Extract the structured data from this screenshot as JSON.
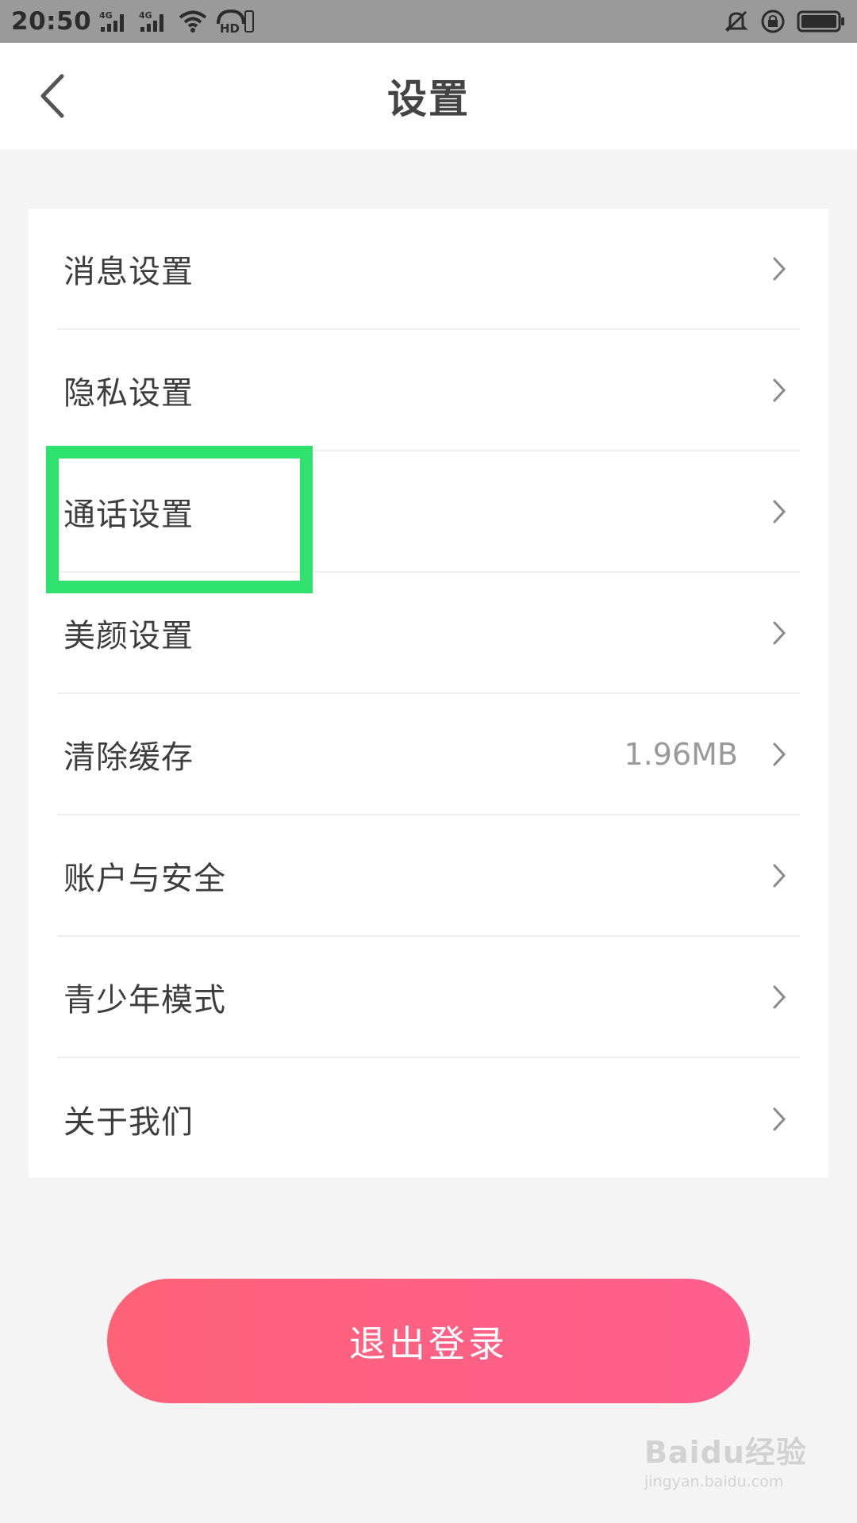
{
  "status_bar": {
    "time": "20:50",
    "network_1": "4G",
    "network_2": "4G",
    "hd_badge": "HD",
    "icons": [
      "signal-icon",
      "signal-icon",
      "wifi-icon",
      "hd-voice-icon",
      "bell-muted-icon",
      "rotation-lock-icon",
      "battery-icon"
    ]
  },
  "header": {
    "title": "设置",
    "back_icon": "chevron-left-icon"
  },
  "settings": {
    "items": [
      {
        "label": "消息设置",
        "value": ""
      },
      {
        "label": "隐私设置",
        "value": ""
      },
      {
        "label": "通话设置",
        "value": ""
      },
      {
        "label": "美颜设置",
        "value": ""
      },
      {
        "label": "清除缓存",
        "value": "1.96MB"
      },
      {
        "label": "账户与安全",
        "value": ""
      },
      {
        "label": "青少年模式",
        "value": ""
      },
      {
        "label": "关于我们",
        "value": ""
      }
    ]
  },
  "logout": {
    "label": "退出登录"
  },
  "watermark": {
    "main": "Baidu经验",
    "sub": "jingyan.baidu.com"
  },
  "colors": {
    "highlight": "#2fe26d",
    "logout_gradient_start": "#fd6277",
    "logout_gradient_end": "#fe5f8f",
    "background": "#f4f4f4"
  }
}
